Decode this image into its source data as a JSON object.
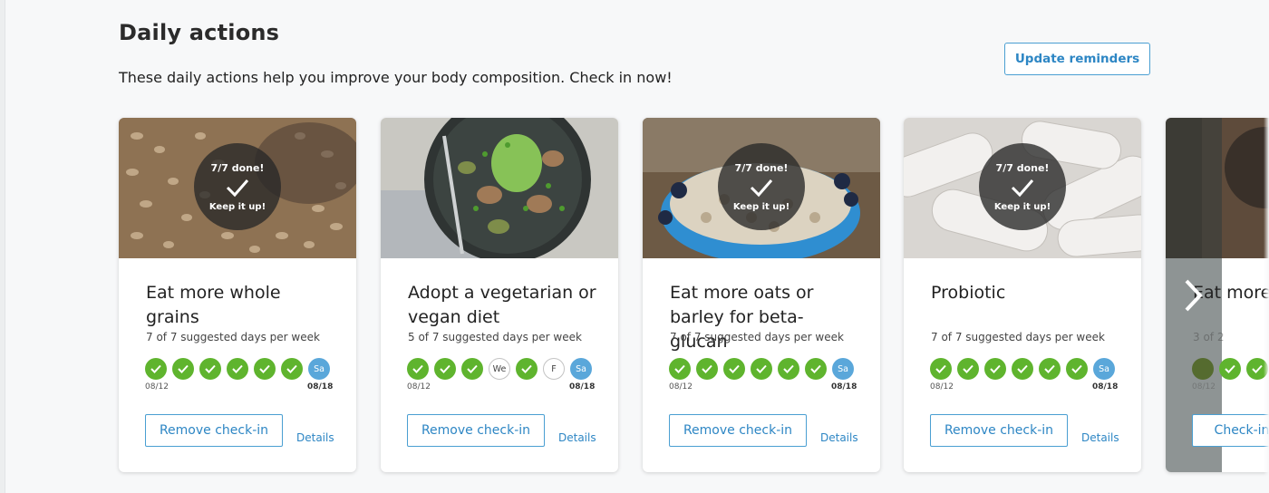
{
  "page": {
    "title": "Daily actions",
    "subtitle": "These daily actions help you improve your body composition. Check in now!",
    "update_button": "Update reminders"
  },
  "colors": {
    "accent": "#2d86c4",
    "done_green": "#5fb42e",
    "today_blue": "#5aa7da"
  },
  "cards": [
    {
      "done_text": "7/7 done!",
      "keep_text": "Keep it up!",
      "title": "Eat more whole grains",
      "frequency": "7 of 7 suggested days per week",
      "days": [
        {
          "state": "done",
          "label": ""
        },
        {
          "state": "done",
          "label": ""
        },
        {
          "state": "done",
          "label": ""
        },
        {
          "state": "done",
          "label": ""
        },
        {
          "state": "done",
          "label": ""
        },
        {
          "state": "done",
          "label": ""
        },
        {
          "state": "today",
          "label": "Sa"
        }
      ],
      "date_start": "08/12",
      "date_end": "08/18",
      "button": "Remove check-in",
      "details": "Details",
      "image": "grains-icon"
    },
    {
      "title": "Adopt a vegetarian or vegan diet",
      "frequency": "5 of 7 suggested days per week",
      "days": [
        {
          "state": "done",
          "label": ""
        },
        {
          "state": "done",
          "label": ""
        },
        {
          "state": "done",
          "label": ""
        },
        {
          "state": "empty",
          "label": "We"
        },
        {
          "state": "done",
          "label": ""
        },
        {
          "state": "empty",
          "label": "F"
        },
        {
          "state": "today",
          "label": "Sa"
        }
      ],
      "date_start": "08/12",
      "date_end": "08/18",
      "button": "Remove check-in",
      "details": "Details",
      "image": "veggie-bowl-icon"
    },
    {
      "done_text": "7/7 done!",
      "keep_text": "Keep it up!",
      "title": "Eat more oats or barley for beta-glucan",
      "frequency": "7 of 7 suggested days per week",
      "days": [
        {
          "state": "done",
          "label": ""
        },
        {
          "state": "done",
          "label": ""
        },
        {
          "state": "done",
          "label": ""
        },
        {
          "state": "done",
          "label": ""
        },
        {
          "state": "done",
          "label": ""
        },
        {
          "state": "done",
          "label": ""
        },
        {
          "state": "today",
          "label": "Sa"
        }
      ],
      "date_start": "08/12",
      "date_end": "08/18",
      "button": "Remove check-in",
      "details": "Details",
      "image": "oats-bowl-icon"
    },
    {
      "done_text": "7/7 done!",
      "keep_text": "Keep it up!",
      "title": "Probiotic",
      "frequency": "7 of 7 suggested days per week",
      "days": [
        {
          "state": "done",
          "label": ""
        },
        {
          "state": "done",
          "label": ""
        },
        {
          "state": "done",
          "label": ""
        },
        {
          "state": "done",
          "label": ""
        },
        {
          "state": "done",
          "label": ""
        },
        {
          "state": "done",
          "label": ""
        },
        {
          "state": "today",
          "label": "Sa"
        }
      ],
      "date_start": "08/12",
      "date_end": "08/18",
      "button": "Remove check-in",
      "details": "Details",
      "image": "capsules-icon"
    },
    {
      "title": "Eat more",
      "frequency": "3 of 2",
      "date_start": "08/12",
      "button": "Check-in",
      "image": "partial-card-image"
    }
  ]
}
